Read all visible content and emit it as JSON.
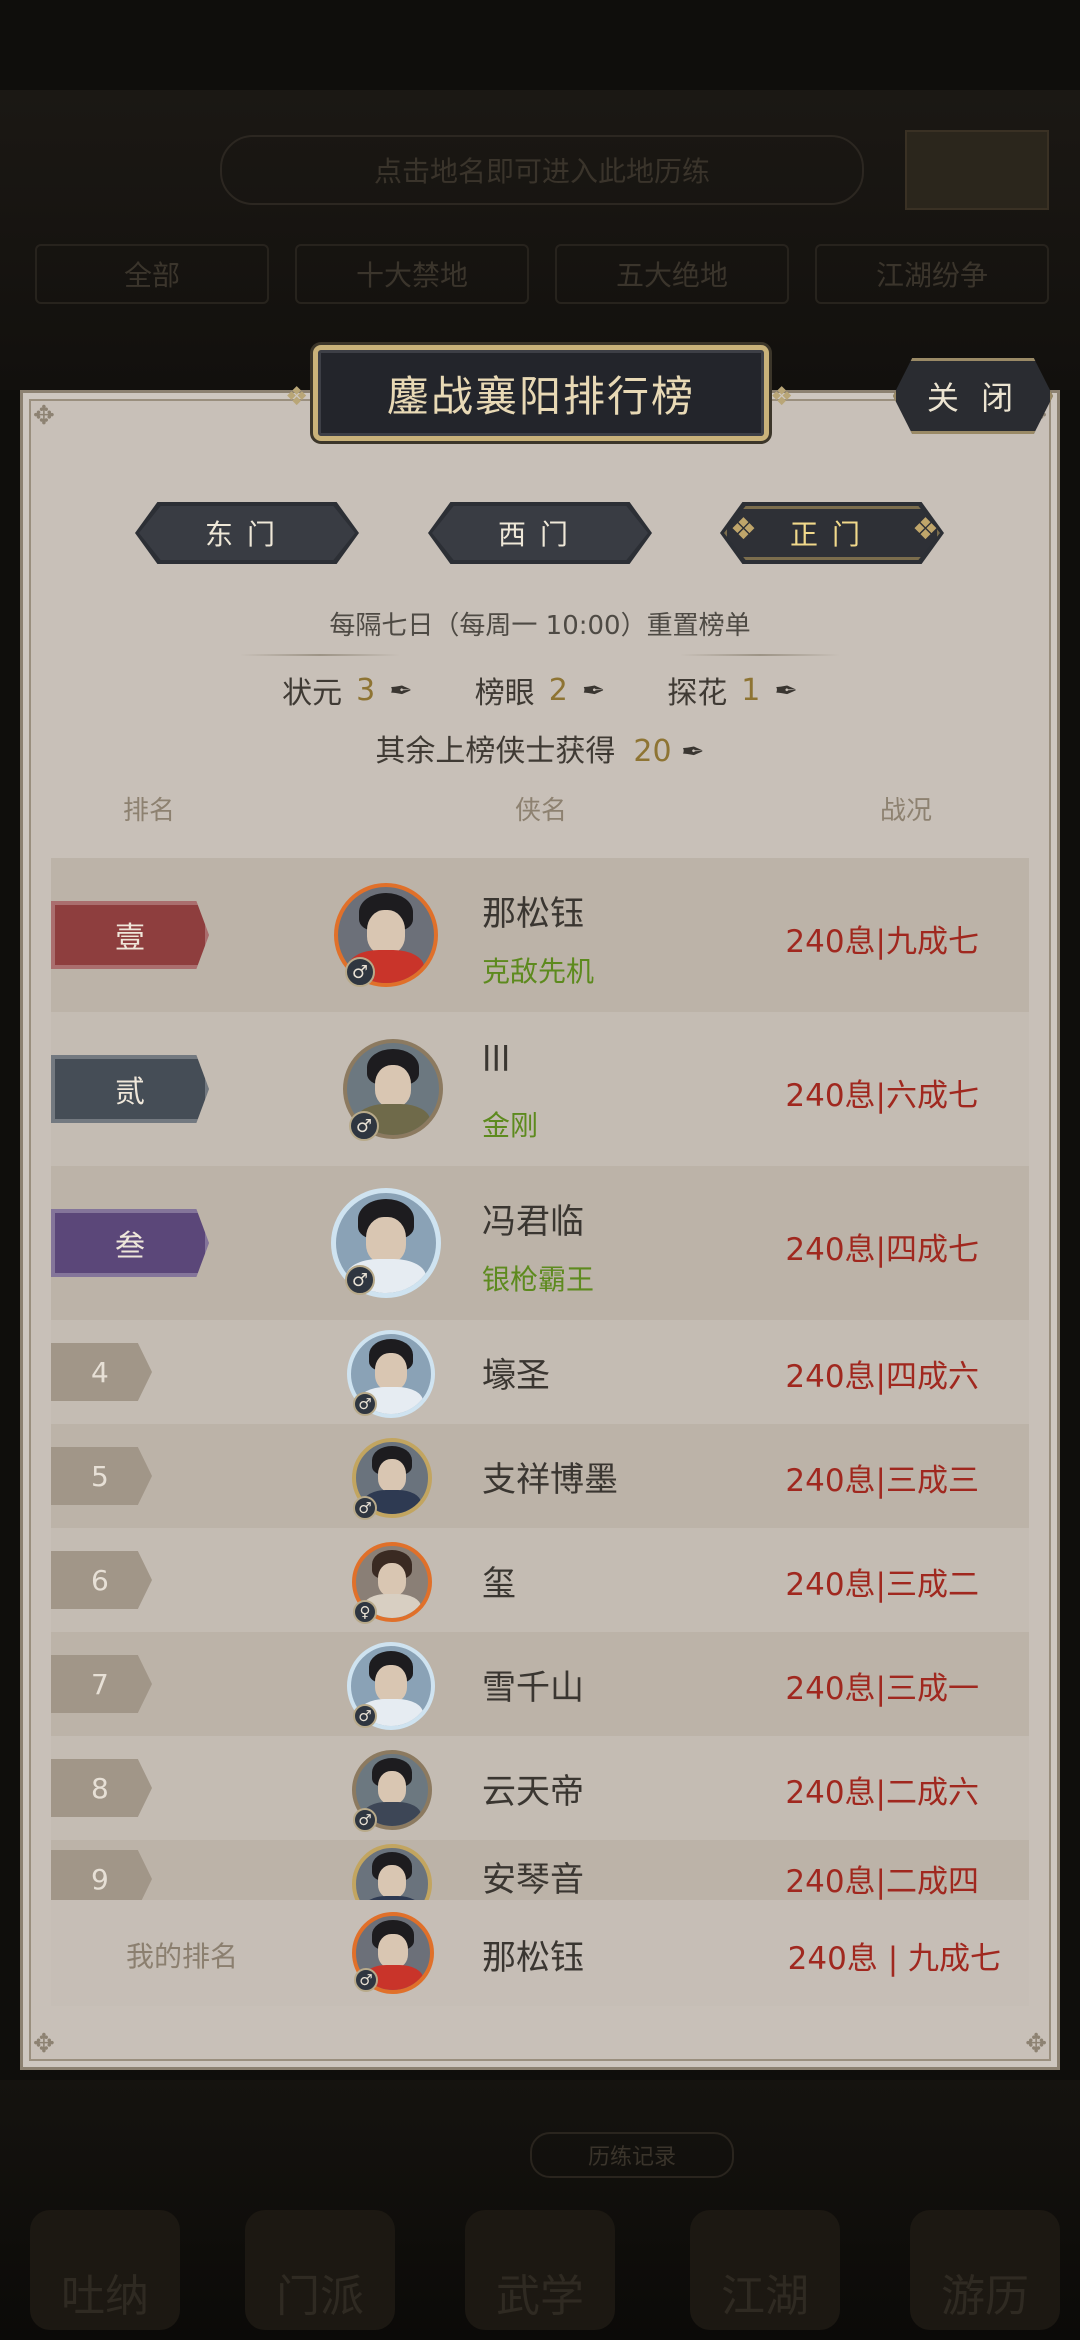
{
  "background": {
    "hint": "点击地名即可进入此地历练",
    "tabs": [
      "全部",
      "十大禁地",
      "五大绝地",
      "江湖纷争"
    ],
    "bottom_hint": "历练记录",
    "nav": [
      "吐纳",
      "门派",
      "武学",
      "江湖",
      "游历"
    ]
  },
  "panel": {
    "title": "鏖战襄阳排行榜",
    "close_label": "关 闭",
    "gates": [
      {
        "label": "东门",
        "active": false
      },
      {
        "label": "西门",
        "active": false
      },
      {
        "label": "正门",
        "active": true
      }
    ],
    "reset_text": "每隔七日（每周一 10:00）重置榜单",
    "rewards": [
      {
        "label": "状元",
        "value": "3"
      },
      {
        "label": "榜眼",
        "value": "2"
      },
      {
        "label": "探花",
        "value": "1"
      }
    ],
    "other_reward_label": "其余上榜侠士获得",
    "other_reward_value": "20",
    "columns": {
      "rank": "排名",
      "name": "侠名",
      "status": "战况"
    }
  },
  "rankings": [
    {
      "rank": "壹",
      "name": "那松钰",
      "title": "克敌先机",
      "status": "240息|九成七"
    },
    {
      "rank": "贰",
      "name": "lll",
      "title": "金刚",
      "status": "240息|六成七"
    },
    {
      "rank": "叁",
      "name": "冯君临",
      "title": "银枪霸王",
      "status": "240息|四成七"
    },
    {
      "rank": "4",
      "name": "壕圣",
      "status": "240息|四成六"
    },
    {
      "rank": "5",
      "name": "支祥博墨",
      "status": "240息|三成三"
    },
    {
      "rank": "6",
      "name": "玺",
      "status": "240息|三成二"
    },
    {
      "rank": "7",
      "name": "雪千山",
      "status": "240息|三成一"
    },
    {
      "rank": "8",
      "name": "云天帝",
      "status": "240息|二成六"
    },
    {
      "rank": "9",
      "name": "安琴音",
      "status": "240息|二成四"
    }
  ],
  "my_rank": {
    "label": "我的排名",
    "name": "那松钰",
    "status": "240息 | 九成七"
  },
  "colors": {
    "accent_gold": "#c9b27a",
    "status_red": "#a0281f",
    "title_green": "#5d8a1e"
  }
}
